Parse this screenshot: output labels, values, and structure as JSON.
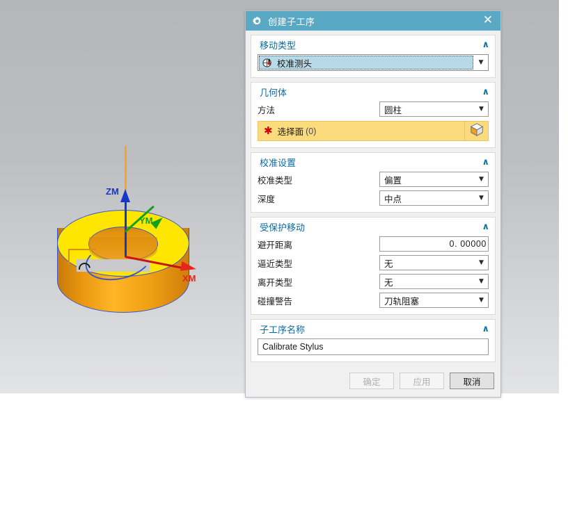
{
  "viewport": {
    "model": {
      "name": "cylinder-ring-part",
      "axes": [
        {
          "id": "zm",
          "label": "ZM",
          "color": "#1538c8"
        },
        {
          "id": "ym",
          "label": "YM",
          "color": "#12a21a"
        },
        {
          "id": "xm",
          "label": "XM",
          "color": "#e8251b"
        }
      ]
    }
  },
  "dialog": {
    "title": "创建子工序",
    "title_icon": "gear-icon",
    "close_label": "✕",
    "groups": [
      {
        "id": "move_type",
        "title": "移动类型",
        "chevron": "∧",
        "combo": {
          "value": "校准测头",
          "icon": "probe-calibration-icon",
          "caret": "▼"
        }
      },
      {
        "id": "geometry",
        "title": "几何体",
        "chevron": "∧",
        "rows": [
          {
            "label": "方法",
            "value": "圆柱",
            "caret": "▼"
          }
        ],
        "select_bar": {
          "star": "✱",
          "label": "选择面",
          "count": "(0)",
          "button_icon": "cube-select-icon"
        }
      },
      {
        "id": "calibration_settings",
        "title": "校准设置",
        "chevron": "∧",
        "rows": [
          {
            "label": "校准类型",
            "value": "偏置",
            "caret": "▼"
          },
          {
            "label": "深度",
            "value": "中点",
            "caret": "▼"
          }
        ]
      },
      {
        "id": "protected_move",
        "title": "受保护移动",
        "chevron": "∧",
        "rows": [
          {
            "label": "避开距离",
            "value": "0. 00000",
            "type": "number"
          },
          {
            "label": "逼近类型",
            "value": "无",
            "caret": "▼"
          },
          {
            "label": "离开类型",
            "value": "无",
            "caret": "▼"
          },
          {
            "label": "碰撞警告",
            "value": "刀轨阻塞",
            "caret": "▼"
          }
        ]
      },
      {
        "id": "suboperation_name",
        "title": "子工序名称",
        "chevron": "∧",
        "text_input": {
          "value": "Calibrate Stylus",
          "placeholder": ""
        }
      }
    ],
    "footer": {
      "ok": "确定",
      "apply": "应用",
      "cancel": "取消",
      "ok_enabled": false,
      "apply_enabled": false,
      "cancel_enabled": true
    }
  },
  "colors": {
    "titlebar": "#59a8c4",
    "group_title": "#0a6a9e",
    "required_star": "#d10000",
    "select_bar": "#fbdb7e",
    "combo_highlight": "#b8d9e8"
  }
}
